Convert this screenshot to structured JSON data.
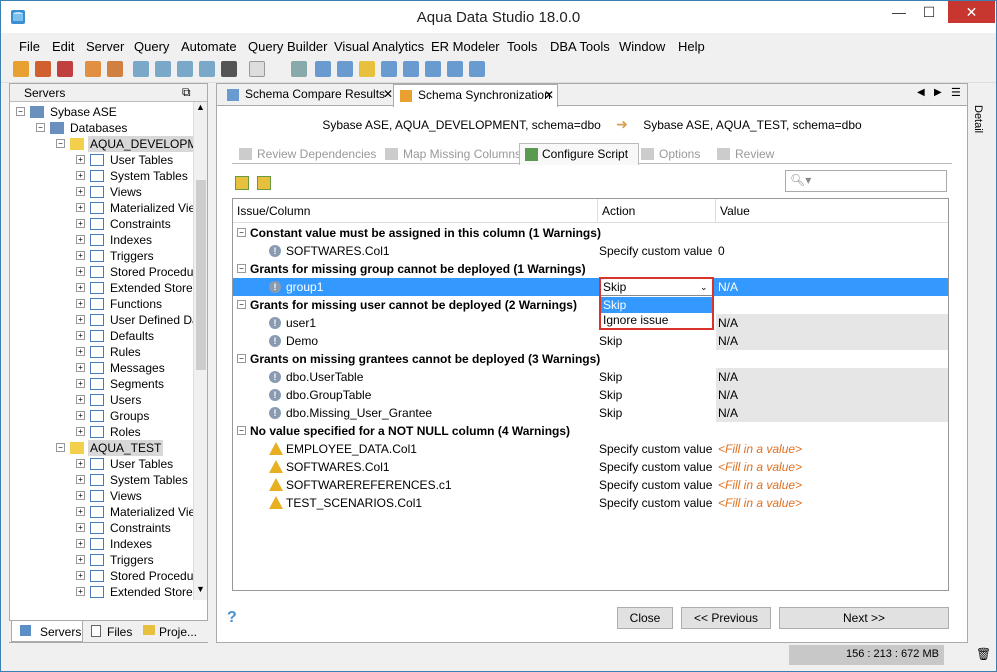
{
  "window": {
    "title": "Aqua Data Studio 18.0.0",
    "minimize": "—",
    "maximize": "☐",
    "close": "✕"
  },
  "menu": [
    "File",
    "Edit",
    "Server",
    "Query",
    "Automate",
    "Query Builder",
    "Visual Analytics",
    "ER Modeler",
    "Tools",
    "DBA Tools",
    "Window",
    "Help"
  ],
  "left_panel": {
    "header": "Servers",
    "tree": [
      {
        "label": "Sybase ASE",
        "indent": 0,
        "icon": "server-icon"
      },
      {
        "label": "Databases",
        "indent": 1,
        "icon": "databases-icon"
      },
      {
        "label": "AQUA_DEVELOPMENT",
        "indent": 2,
        "icon": "database-icon",
        "highlight": true
      },
      {
        "label": "User Tables",
        "indent": 3,
        "icon": "folder-icon"
      },
      {
        "label": "System Tables",
        "indent": 3,
        "icon": "folder-icon"
      },
      {
        "label": "Views",
        "indent": 3,
        "icon": "folder-icon"
      },
      {
        "label": "Materialized Views",
        "indent": 3,
        "icon": "folder-icon"
      },
      {
        "label": "Constraints",
        "indent": 3,
        "icon": "folder-icon"
      },
      {
        "label": "Indexes",
        "indent": 3,
        "icon": "folder-icon"
      },
      {
        "label": "Triggers",
        "indent": 3,
        "icon": "folder-icon"
      },
      {
        "label": "Stored Procedures",
        "indent": 3,
        "icon": "folder-icon"
      },
      {
        "label": "Extended Stored",
        "indent": 3,
        "icon": "folder-icon"
      },
      {
        "label": "Functions",
        "indent": 3,
        "icon": "folder-icon"
      },
      {
        "label": "User Defined Data",
        "indent": 3,
        "icon": "folder-icon"
      },
      {
        "label": "Defaults",
        "indent": 3,
        "icon": "folder-icon"
      },
      {
        "label": "Rules",
        "indent": 3,
        "icon": "folder-icon"
      },
      {
        "label": "Messages",
        "indent": 3,
        "icon": "folder-icon"
      },
      {
        "label": "Segments",
        "indent": 3,
        "icon": "folder-icon"
      },
      {
        "label": "Users",
        "indent": 3,
        "icon": "folder-icon"
      },
      {
        "label": "Groups",
        "indent": 3,
        "icon": "folder-icon"
      },
      {
        "label": "Roles",
        "indent": 3,
        "icon": "folder-icon"
      },
      {
        "label": "AQUA_TEST",
        "indent": 2,
        "icon": "database-icon",
        "highlight": true
      },
      {
        "label": "User Tables",
        "indent": 3,
        "icon": "folder-icon"
      },
      {
        "label": "System Tables",
        "indent": 3,
        "icon": "folder-icon"
      },
      {
        "label": "Views",
        "indent": 3,
        "icon": "folder-icon"
      },
      {
        "label": "Materialized Views",
        "indent": 3,
        "icon": "folder-icon"
      },
      {
        "label": "Constraints",
        "indent": 3,
        "icon": "folder-icon"
      },
      {
        "label": "Indexes",
        "indent": 3,
        "icon": "folder-icon"
      },
      {
        "label": "Triggers",
        "indent": 3,
        "icon": "folder-icon"
      },
      {
        "label": "Stored Procedures",
        "indent": 3,
        "icon": "folder-icon"
      },
      {
        "label": "Extended Stored",
        "indent": 3,
        "icon": "folder-icon"
      }
    ],
    "tabs": [
      "Servers",
      "Files",
      "Proje..."
    ]
  },
  "doc_tabs": [
    "Schema Compare Results",
    "Schema Synchronization"
  ],
  "compare": {
    "source": "Sybase ASE, AQUA_DEVELOPMENT, schema=dbo",
    "target": "Sybase ASE, AQUA_TEST, schema=dbo"
  },
  "wizard_tabs": [
    "Review Dependencies",
    "Map Missing Columns",
    "Configure Script",
    "Options",
    "Review"
  ],
  "detail_label": "Detail",
  "grid": {
    "columns": [
      "Issue/Column",
      "Action",
      "Value"
    ],
    "rows": [
      {
        "type": "group",
        "label": "Constant value must be assigned in this column (1 Warnings)"
      },
      {
        "type": "item",
        "icon": "info",
        "label": "SOFTWARES.Col1",
        "action": "Specify custom value",
        "value": "0"
      },
      {
        "type": "group",
        "label": "Grants for missing group cannot be deployed (1 Warnings)"
      },
      {
        "type": "item",
        "icon": "info",
        "label": "group1",
        "action": "Skip",
        "value": "N/A",
        "selected": true
      },
      {
        "type": "group",
        "label": "Grants for missing user cannot be deployed (2 Warnings)"
      },
      {
        "type": "item",
        "icon": "info",
        "label": "user1",
        "action": "",
        "value": "N/A"
      },
      {
        "type": "item",
        "icon": "info",
        "label": "Demo",
        "action": "Skip",
        "value": "N/A"
      },
      {
        "type": "group",
        "label": "Grants on missing grantees cannot be deployed (3 Warnings)"
      },
      {
        "type": "item",
        "icon": "info",
        "label": "dbo.UserTable",
        "action": "Skip",
        "value": "N/A"
      },
      {
        "type": "item",
        "icon": "info",
        "label": "dbo.GroupTable",
        "action": "Skip",
        "value": "N/A"
      },
      {
        "type": "item",
        "icon": "info",
        "label": "dbo.Missing_User_Grantee",
        "action": "Skip",
        "value": "N/A"
      },
      {
        "type": "group",
        "label": "No value specified for a NOT NULL column (4 Warnings)"
      },
      {
        "type": "item",
        "icon": "warn",
        "label": "EMPLOYEE_DATA.Col1",
        "action": "Specify custom value",
        "value": "<Fill in a value>",
        "fill": true
      },
      {
        "type": "item",
        "icon": "warn",
        "label": "SOFTWARES.Col1",
        "action": "Specify custom value",
        "value": "<Fill in a value>",
        "fill": true
      },
      {
        "type": "item",
        "icon": "warn",
        "label": "SOFTWAREREFERENCES.c1",
        "action": "Specify custom value",
        "value": "<Fill in a value>",
        "fill": true
      },
      {
        "type": "item",
        "icon": "warn",
        "label": "TEST_SCENARIOS.Col1",
        "action": "Specify custom value",
        "value": "<Fill in a value>",
        "fill": true
      }
    ]
  },
  "dropdown": {
    "value": "Skip",
    "options": [
      "Skip",
      "Ignore issue"
    ]
  },
  "buttons": {
    "close": "Close",
    "previous": "<< Previous",
    "next": "Next >>",
    "help": "?"
  },
  "status": {
    "memory": "156 : 213 : 672 MB"
  }
}
